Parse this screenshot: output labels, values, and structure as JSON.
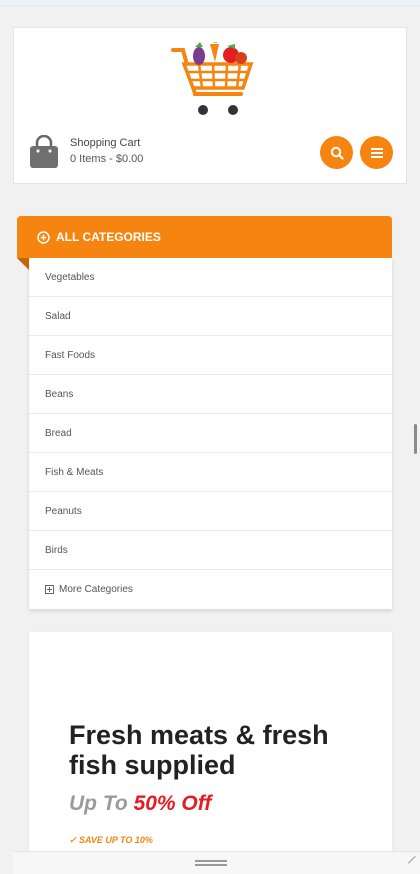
{
  "header": {
    "cart_title": "Shopping Cart",
    "cart_summary": "0 Items - $0.00",
    "search_icon": "search-icon",
    "menu_icon": "hamburger-menu-icon"
  },
  "categories": {
    "heading": "ALL CATEGORIES",
    "items": [
      {
        "label": "Vegetables"
      },
      {
        "label": "Salad"
      },
      {
        "label": "Fast Foods"
      },
      {
        "label": "Beans"
      },
      {
        "label": "Bread"
      },
      {
        "label": "Fish & Meats"
      },
      {
        "label": "Peanuts"
      },
      {
        "label": "Birds"
      }
    ],
    "more_label": "More Categories"
  },
  "promo": {
    "title": "Fresh meats & fresh fish supplied",
    "upto": "Up To",
    "percent": "50% Off",
    "save": "SAVE UP TO 10%"
  },
  "colors": {
    "accent": "#f58411",
    "offer_red": "#e51d23"
  }
}
